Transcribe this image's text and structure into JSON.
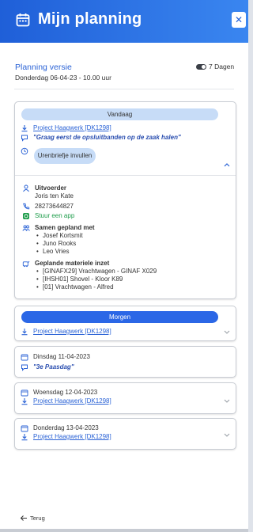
{
  "header": {
    "title": "Mijn planning",
    "close_label": "✕"
  },
  "planning": {
    "title": "Planning versie",
    "date": "Donderdag 06-04-23 - 10.00 uur",
    "days_label": "7 Dagen"
  },
  "today": {
    "pill": "Vandaag",
    "project": "Project Haagwerk [DK1298]",
    "note": "\"Graag eerst de opsluitbanden op de zaak halen\"",
    "hours_button": "Urenbriefje invullen",
    "uitvoerder_label": "Uitvoerder",
    "uitvoerder_name": "Joris ten Kate",
    "phone": "28273644827",
    "app_label": "Stuur een app",
    "samen_label": "Samen gepland met",
    "samen": [
      "Josef Kortsmit",
      "Juno Rooks",
      "Leo Vries"
    ],
    "materieel_label": "Geplande materiele inzet",
    "materieel": [
      "[GINAFX29] Vrachtwagen - GINAF X029",
      "[IHSH01] Shovel - Kloor K89",
      "[01] Vrachtwagen - Alfred"
    ]
  },
  "tomorrow": {
    "pill": "Morgen",
    "project": "Project Haagwerk [DK1298]"
  },
  "days": [
    {
      "date": "Dinsdag 11-04-2023",
      "note": "\"3e Paasdag\""
    },
    {
      "date": "Woensdag 12-04-2023",
      "project": "Project Haagwerk [DK1298]"
    },
    {
      "date": "Donderdag 13-04-2023",
      "project": "Project Haagwerk [DK1298]"
    }
  ],
  "footer": {
    "back_label": "Terug"
  },
  "colors": {
    "brand": "#1f5fd8",
    "link": "#2b63d6",
    "green": "#1c9c49",
    "pill": "#c7dcf7"
  }
}
